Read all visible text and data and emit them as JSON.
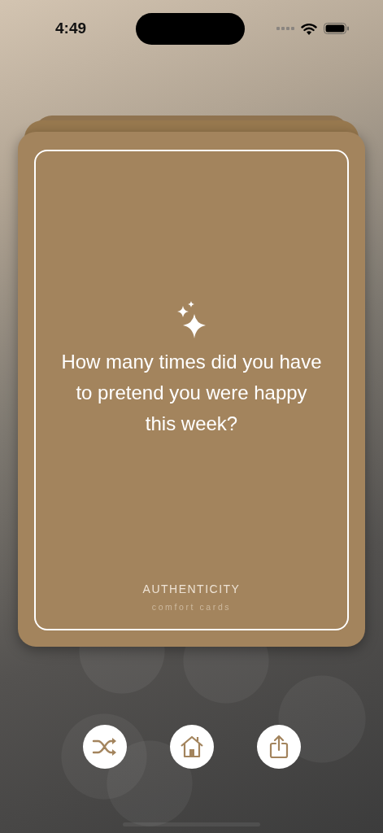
{
  "status_bar": {
    "time": "4:49"
  },
  "card": {
    "question": "How many times did you have to pretend you were happy this week?",
    "category": "AUTHENTICITY",
    "subtitle": "comfort cards"
  },
  "buttons": [
    {
      "kind": "shuffle"
    },
    {
      "kind": "home"
    },
    {
      "kind": "share"
    }
  ]
}
